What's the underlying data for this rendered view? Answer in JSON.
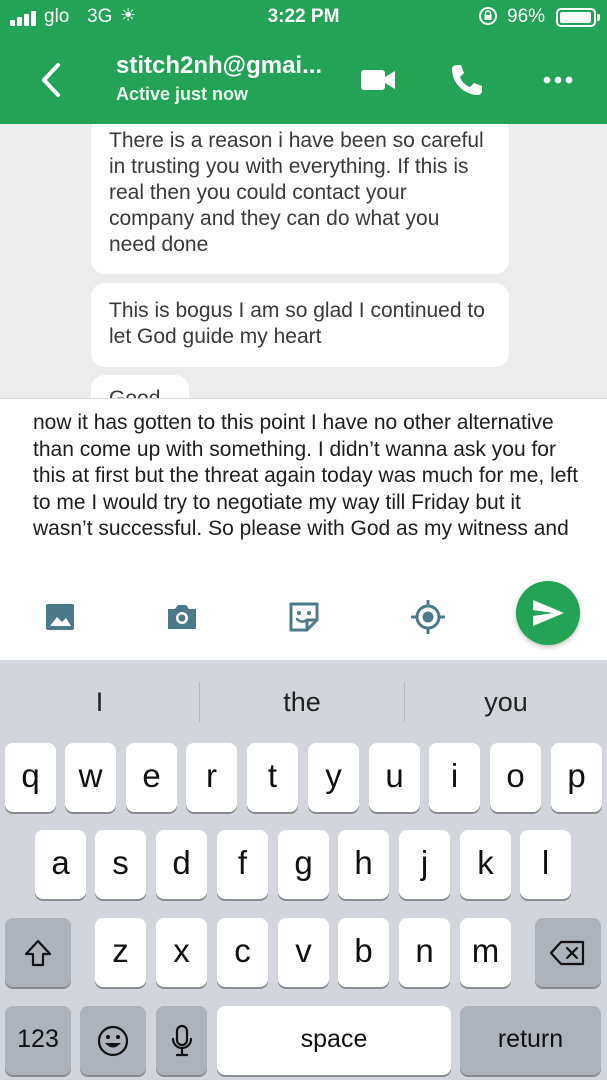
{
  "status_bar": {
    "carrier": "glo",
    "network": "3G",
    "time": "3:22 PM",
    "battery_text": "96%",
    "battery_level": 0.96,
    "icons": [
      "signal-icon",
      "activity-spinner-icon",
      "orientation-lock-icon",
      "battery-icon"
    ]
  },
  "header": {
    "contact_name": "stitch2nh@gmai...",
    "contact_status": "Active just now",
    "icons": [
      "back-chevron-icon",
      "video-call-icon",
      "phone-icon",
      "more-icon"
    ],
    "accent_color": "#22a356"
  },
  "messages": [
    {
      "text": "There is a reason i have been so careful in trusting you with everything. If this is real then you could contact your company and they can do what you need done"
    },
    {
      "text": "This is bogus I am so glad I continued to let God guide my heart"
    },
    {
      "text": "Good"
    }
  ],
  "composer": {
    "draft_text": "now it has gotten to this point I have no other alternative than come up with something. I didn’t wanna ask you for this at first but the threat again today was much for me, left to me I would try to negotiate my way till Friday but it wasn’t successful. So please with God as my witness and",
    "icons": [
      "gallery-icon",
      "camera-icon",
      "sticker-icon",
      "location-icon",
      "send-icon"
    ]
  },
  "keyboard": {
    "suggestions": [
      "I",
      "the",
      "you"
    ],
    "row1": [
      "q",
      "w",
      "e",
      "r",
      "t",
      "y",
      "u",
      "i",
      "o",
      "p"
    ],
    "row2": [
      "a",
      "s",
      "d",
      "f",
      "g",
      "h",
      "j",
      "k",
      "l"
    ],
    "row3": [
      "z",
      "x",
      "c",
      "v",
      "b",
      "n",
      "m"
    ],
    "numbers_label": "123",
    "space_label": "space",
    "return_label": "return",
    "icons": [
      "shift-icon",
      "backspace-icon",
      "emoji-icon",
      "microphone-icon"
    ]
  }
}
